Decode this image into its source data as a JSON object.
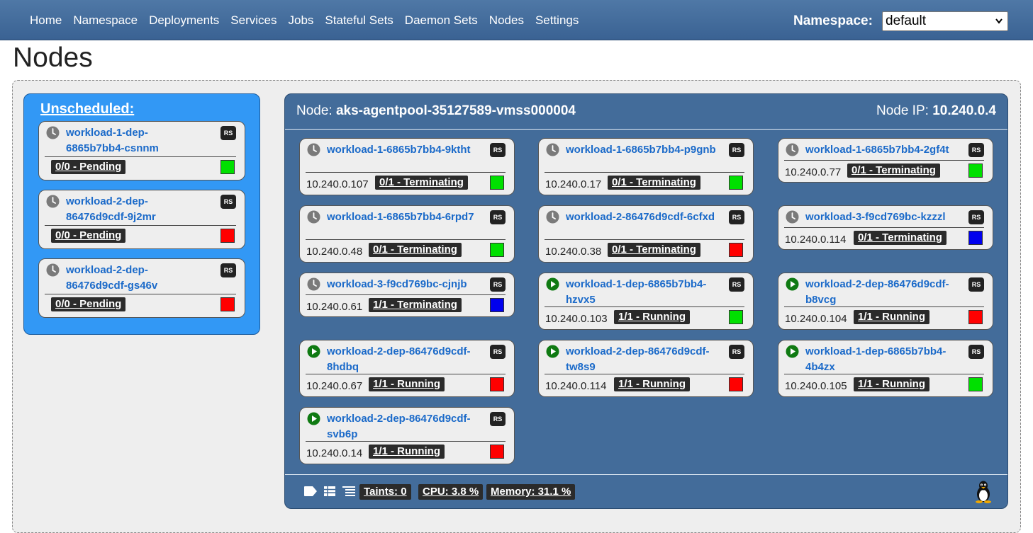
{
  "nav": {
    "items": [
      "Home",
      "Namespace",
      "Deployments",
      "Services",
      "Jobs",
      "Stateful Sets",
      "Daemon Sets",
      "Nodes",
      "Settings"
    ],
    "namespace_label": "Namespace:",
    "namespace_value": "default"
  },
  "page": {
    "title": "Nodes"
  },
  "unscheduled": {
    "title": "Unscheduled:",
    "pods": [
      {
        "name": "workload-1-dep-6865b7bb4-csnnm",
        "kind": "RS",
        "status": "0/0 - Pending",
        "color": "#00e000"
      },
      {
        "name": "workload-2-dep-86476d9cdf-9j2mr",
        "kind": "RS",
        "status": "0/0 - Pending",
        "color": "#ff0000"
      },
      {
        "name": "workload-2-dep-86476d9cdf-gs46v",
        "kind": "RS",
        "status": "0/0 - Pending",
        "color": "#ff0000"
      }
    ]
  },
  "node": {
    "name_label": "Node:",
    "name": "aks-agentpool-35127589-vmss000004",
    "ip_label": "Node IP:",
    "ip": "10.240.0.4",
    "pods": [
      {
        "name": "workload-1-6865b7bb4-9ktht",
        "kind": "RS",
        "ip": "10.240.0.107",
        "status": "0/1 - Terminating",
        "color": "#00e000",
        "state": "pending"
      },
      {
        "name": "workload-1-6865b7bb4-p9gnb",
        "kind": "RS",
        "ip": "10.240.0.17",
        "status": "0/1 - Terminating",
        "color": "#00e000",
        "state": "pending"
      },
      {
        "name": "workload-1-6865b7bb4-2gf4t",
        "kind": "RS",
        "ip": "10.240.0.77",
        "status": "0/1 - Terminating",
        "color": "#00e000",
        "state": "pending"
      },
      {
        "name": "workload-1-6865b7bb4-6rpd7",
        "kind": "RS",
        "ip": "10.240.0.48",
        "status": "0/1 - Terminating",
        "color": "#00e000",
        "state": "pending"
      },
      {
        "name": "workload-2-86476d9cdf-6cfxd",
        "kind": "RS",
        "ip": "10.240.0.38",
        "status": "0/1 - Terminating",
        "color": "#ff0000",
        "state": "pending"
      },
      {
        "name": "workload-3-f9cd769bc-kzzzl",
        "kind": "RS",
        "ip": "10.240.0.114",
        "status": "0/1 - Terminating",
        "color": "#0000ee",
        "state": "pending"
      },
      {
        "name": "workload-3-f9cd769bc-cjnjb",
        "kind": "RS",
        "ip": "10.240.0.61",
        "status": "1/1 - Terminating",
        "color": "#0000ee",
        "state": "pending"
      },
      {
        "name": "workload-1-dep-6865b7bb4-hzvx5",
        "kind": "RS",
        "ip": "10.240.0.103",
        "status": "1/1 - Running",
        "color": "#00e000",
        "state": "running"
      },
      {
        "name": "workload-2-dep-86476d9cdf-b8vcg",
        "kind": "RS",
        "ip": "10.240.0.104",
        "status": "1/1 - Running",
        "color": "#ff0000",
        "state": "running"
      },
      {
        "name": "workload-2-dep-86476d9cdf-8hdbq",
        "kind": "RS",
        "ip": "10.240.0.67",
        "status": "1/1 - Running",
        "color": "#ff0000",
        "state": "running"
      },
      {
        "name": "workload-2-dep-86476d9cdf-tw8s9",
        "kind": "RS",
        "ip": "10.240.0.114",
        "status": "1/1 - Running",
        "color": "#ff0000",
        "state": "running"
      },
      {
        "name": "workload-1-dep-6865b7bb4-4b4zx",
        "kind": "RS",
        "ip": "10.240.0.105",
        "status": "1/1 - Running",
        "color": "#00e000",
        "state": "running"
      },
      {
        "name": "workload-2-dep-86476d9cdf-svb6p",
        "kind": "RS",
        "ip": "10.240.0.14",
        "status": "1/1 - Running",
        "color": "#ff0000",
        "state": "running"
      }
    ],
    "footer": {
      "taints": "Taints: 0",
      "cpu": "CPU: 3.8 %",
      "memory": "Memory: 31.1 %",
      "icons": [
        "tag-icon",
        "table-icon",
        "list-icon",
        "linux-icon"
      ]
    }
  }
}
